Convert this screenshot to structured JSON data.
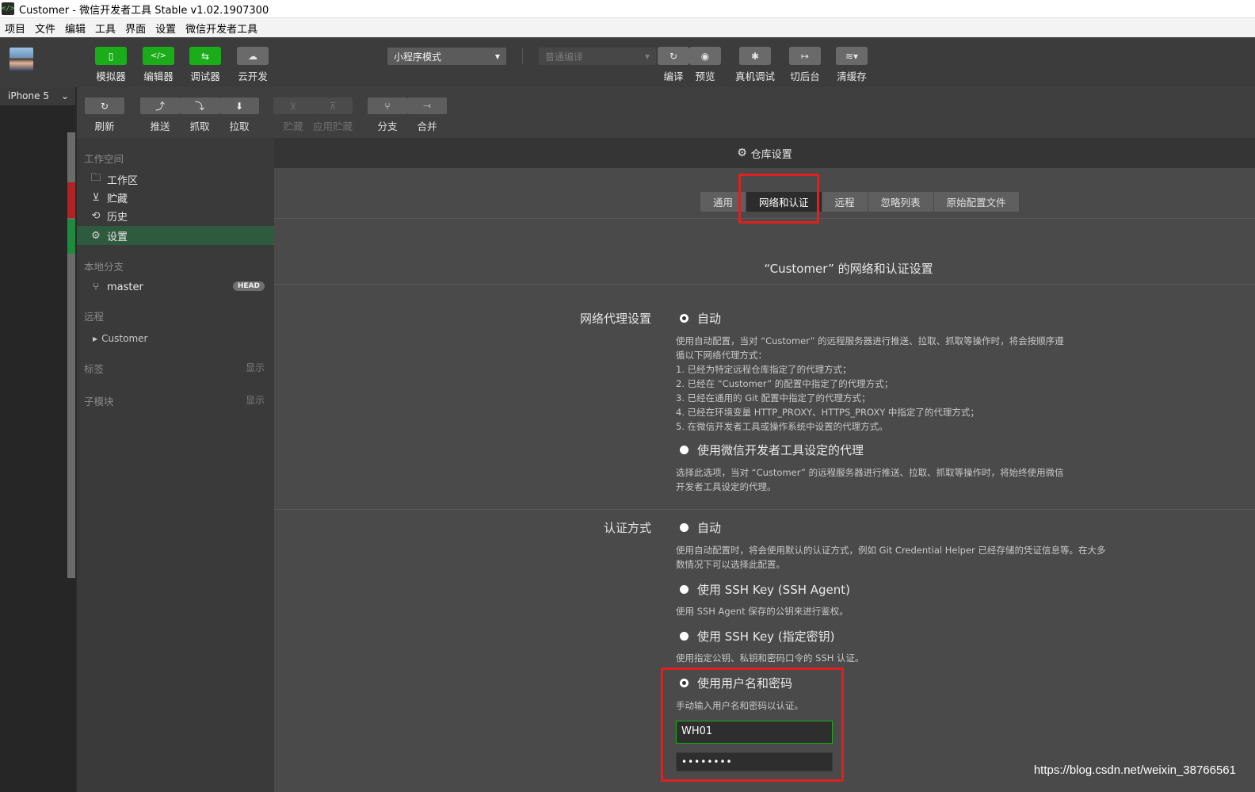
{
  "window": {
    "title": "Customer - 微信开发者工具 Stable v1.02.1907300",
    "app_icon": "</>"
  },
  "menu": [
    "项目",
    "文件",
    "编辑",
    "工具",
    "界面",
    "设置",
    "微信开发者工具"
  ],
  "toolbar": {
    "simulator": "模拟器",
    "editor": "编辑器",
    "debugger": "调试器",
    "cloud": "云开发",
    "mode": "小程序模式",
    "compile_mode": "普通编译",
    "compile": "编译",
    "preview": "预览",
    "remote_debug": "真机调试",
    "background": "切后台",
    "clear_cache": "清缓存"
  },
  "device": {
    "name": "iPhone 5"
  },
  "git_toolbar": {
    "refresh": "刷新",
    "push": "推送",
    "fetch": "抓取",
    "pull": "拉取",
    "stash": "贮藏",
    "apply_stash": "应用贮藏",
    "branch": "分支",
    "merge": "合并"
  },
  "git_panel": {
    "workspace_title": "工作空间",
    "workspace_items": [
      "工作区",
      "贮藏",
      "历史",
      "设置"
    ],
    "local_branches_title": "本地分支",
    "branch": "master",
    "head_badge": "HEAD",
    "remote_title": "远程",
    "remote_item": "Customer",
    "tags_title": "标签",
    "submodules_title": "子模块",
    "show": "显示"
  },
  "settings": {
    "header": "仓库设置",
    "tabs": [
      "通用",
      "网络和认证",
      "远程",
      "忽略列表",
      "原始配置文件"
    ],
    "active_tab": "网络和认证",
    "heading": "“Customer” 的网络和认证设置",
    "proxy_label": "网络代理设置",
    "proxy_auto": "自动",
    "proxy_auto_desc": [
      "使用自动配置，当对 “Customer” 的远程服务器进行推送、拉取、抓取等操作时，将会按顺序遵",
      "循以下网络代理方式：",
      "1. 已经为特定远程仓库指定了的代理方式；",
      "2. 已经在 “Customer” 的配置中指定了的代理方式；",
      "3. 已经在通用的 Git 配置中指定了的代理方式；",
      "4. 已经在环境变量 HTTP_PROXY、HTTPS_PROXY 中指定了的代理方式；",
      "5. 在微信开发者工具或操作系统中设置的代理方式。"
    ],
    "proxy_wechat": "使用微信开发者工具设定的代理",
    "proxy_wechat_desc": [
      "选择此选项，当对 “Customer” 的远程服务器进行推送、拉取、抓取等操作时，将始终使用微信",
      "开发者工具设定的代理。"
    ],
    "auth_label": "认证方式",
    "auth_auto": "自动",
    "auth_auto_desc": [
      "使用自动配置时，将会使用默认的认证方式，例如 Git Credential Helper 已经存储的凭证信息等。在大多",
      "数情况下可以选择此配置。"
    ],
    "auth_ssh_agent": "使用 SSH Key (SSH Agent)",
    "auth_ssh_agent_desc": "使用 SSH Agent 保存的公钥来进行鉴权。",
    "auth_ssh_key": "使用 SSH Key (指定密钥)",
    "auth_ssh_key_desc": "使用指定公钥、私钥和密码口令的 SSH 认证。",
    "auth_userpass": "使用用户名和密码",
    "auth_userpass_desc": "手动输入用户名和密码以认证。",
    "username": "WH01",
    "password": "••••••••"
  },
  "watermark": "https://blog.csdn.net/weixin_38766561",
  "colors": {
    "accent_green": "#1aad19",
    "highlight_red": "#e02020"
  }
}
